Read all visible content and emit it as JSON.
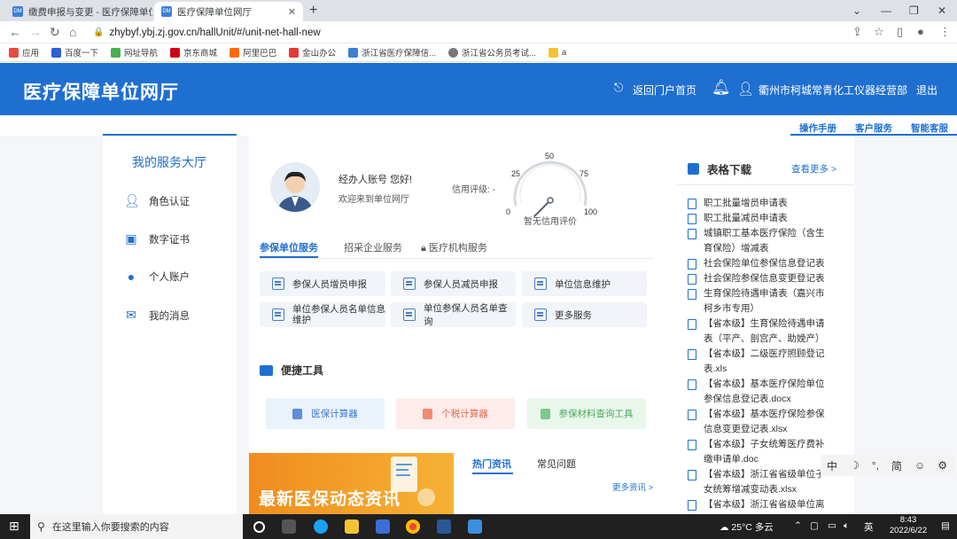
{
  "browser": {
    "tabs": [
      {
        "title": "缴费申报与变更 - 医疗保障单位网"
      },
      {
        "title": "医疗保障单位网厅"
      }
    ],
    "url": "zhybyf.ybj.zj.gov.cn/hallUnit/#/unit-net-hall-new",
    "bookmarks": [
      "应用",
      "百度一下",
      "网址导航",
      "京东商城",
      "阿里巴巴",
      "金山办公",
      "浙江省医疗保障信...",
      "浙江省公务员考试...",
      "a"
    ]
  },
  "header": {
    "title": "医疗保障单位网厅",
    "home_link": "返回门户首页",
    "company": "衢州市柯城常青化工仪器经营部",
    "logout": "退出"
  },
  "subnav": [
    "操作手册",
    "客户服务",
    "智能客服"
  ],
  "sidebar": {
    "title": "我的服务大厅",
    "items": [
      {
        "label": "角色认证"
      },
      {
        "label": "数字证书"
      },
      {
        "label": "个人账户"
      },
      {
        "label": "我的消息"
      }
    ]
  },
  "profile": {
    "greeting": "经办人账号 您好!",
    "welcome": "欢迎来到单位网厅",
    "credit_label": "信用评级:",
    "credit_value": "-",
    "gauge_ticks": [
      "0",
      "25",
      "50",
      "75",
      "100"
    ],
    "gauge_caption": "暂无信用评价",
    "gauge_value": 0
  },
  "tabs": [
    "参保单位服务",
    "招采企业服务",
    "医疗机构服务"
  ],
  "services": [
    "参保人员增员申报",
    "参保人员减员申报",
    "单位信息维护",
    "单位参保人员名单信息维护",
    "单位参保人员名单查询",
    "更多服务"
  ],
  "quick_tools": {
    "title": "便捷工具",
    "items": [
      "医保计算器",
      "个税计算器",
      "参保材料查询工具"
    ]
  },
  "banner": {
    "title": "最新医保动态资讯"
  },
  "news": {
    "tabs": [
      "热门资讯",
      "常见问题"
    ],
    "more": "更多资讯 >"
  },
  "forms": {
    "title": "表格下载",
    "more": "查看更多 >",
    "items": [
      "职工批量增员申请表",
      "职工批量减员申请表",
      "城镇职工基本医疗保险（含生育保险）增减表",
      "社会保险单位参保信息登记表",
      "社会保险参保信息变更登记表",
      "生育保险待遇申请表（嘉兴市柯乡市专用）",
      "【省本级】生育保险待遇申请表（平产、剖宫产、助娩产）",
      "【省本级】二级医疗照顾登记表.xls",
      "【省本级】基本医疗保险单位参保信息登记表.docx",
      "【省本级】基本医疗保险参保信息变更登记表.xlsx",
      "【省本级】子女统筹医疗费补缴申请单.doc",
      "【省本级】浙江省省级单位子女统筹增减变动表.xlsx",
      "【省本级】浙江省省级单位离休"
    ]
  },
  "ime": [
    "中",
    "☽",
    "°,",
    "简",
    "☺",
    "⚙"
  ],
  "taskbar": {
    "search_placeholder": "在这里输入你要搜索的内容",
    "weather": "25°C 多云",
    "lang": "英",
    "time": "8:43",
    "date": "2022/6/22"
  }
}
